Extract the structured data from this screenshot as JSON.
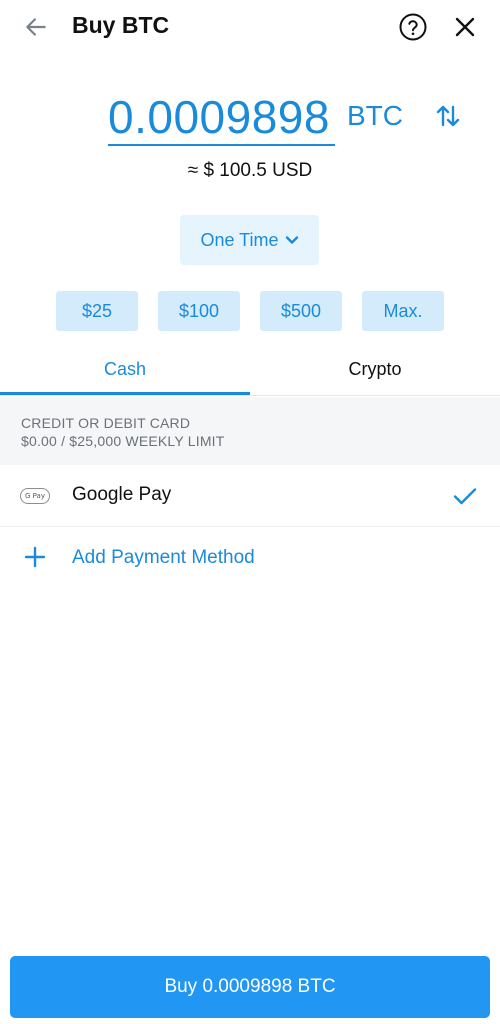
{
  "header": {
    "title": "Buy BTC",
    "back_icon": "arrow-left-icon",
    "help_icon": "help-circle-icon",
    "close_icon": "close-icon"
  },
  "amount": {
    "value": "0.0009898",
    "unit": "BTC",
    "usd_equivalent": "≈ $ 100.5 USD",
    "swap_icon": "swap-vertical-icon"
  },
  "frequency": {
    "selected": "One Time",
    "icon": "chevron-down-icon"
  },
  "quick_amounts": [
    "$25",
    "$100",
    "$500",
    "Max."
  ],
  "tabs": [
    {
      "label": "Cash",
      "active": true
    },
    {
      "label": "Crypto",
      "active": false
    }
  ],
  "payment_section": {
    "title": "CREDIT OR DEBIT CARD",
    "limit": "$0.00 / $25,000 WEEKLY LIMIT"
  },
  "payment_methods": [
    {
      "label": "Google Pay",
      "badge": "G Pay",
      "selected": true
    }
  ],
  "add_payment": {
    "label": "Add Payment Method",
    "icon": "plus-icon"
  },
  "buy_button": {
    "label": "Buy 0.0009898 BTC"
  },
  "colors": {
    "accent": "#1a8bdb",
    "button": "#2196f3",
    "chip_bg": "#d4ebfb",
    "section_bg": "#f4f6f8"
  }
}
